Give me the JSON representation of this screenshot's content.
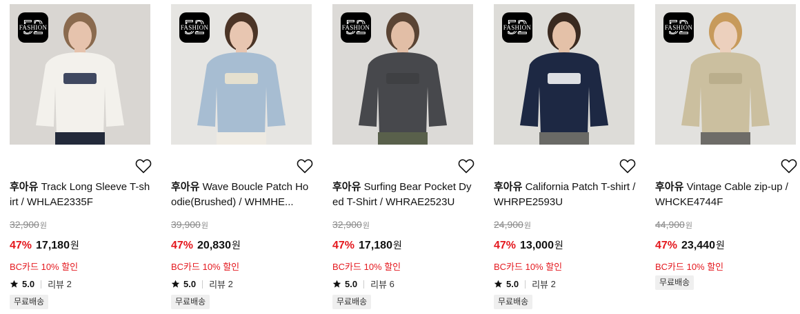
{
  "badge": {
    "number": "52",
    "word": "FASHION"
  },
  "products": [
    {
      "brand": "후아유",
      "name": "Track Long Sleeve T-shirt / WHLAE2335F",
      "original_price": "32,900",
      "currency": "원",
      "discount_rate": "47%",
      "sale_price": "17,180",
      "card_promo": "BC카드 10% 할인",
      "rating": "5.0",
      "review_label": "리뷰",
      "review_count": "2",
      "shipping_tag": "무료배송",
      "colors": {
        "bg": "#d9d6d2",
        "top": "#f3f1ec",
        "accent": "#1e2a48",
        "bottom": "#232a3a",
        "skin": "#e6c3ad",
        "hair": "#8a6a4e"
      }
    },
    {
      "brand": "후아유",
      "name": "Wave Boucle Patch Hoodie(Brushed) / WHMHE...",
      "original_price": "39,900",
      "currency": "원",
      "discount_rate": "47%",
      "sale_price": "20,830",
      "card_promo": "BC카드 10% 할인",
      "rating": "5.0",
      "review_label": "리뷰",
      "review_count": "2",
      "shipping_tag": "무료배송",
      "colors": {
        "bg": "#e6e5e2",
        "top": "#a7bdd2",
        "accent": "#f0e6cf",
        "bottom": "#eeeae2",
        "skin": "#e8c6b1",
        "hair": "#4b3426"
      }
    },
    {
      "brand": "후아유",
      "name": "Surfing Bear Pocket Dyed T-Shirt / WHRAE2523U",
      "original_price": "32,900",
      "currency": "원",
      "discount_rate": "47%",
      "sale_price": "17,180",
      "card_promo": "BC카드 10% 할인",
      "rating": "5.0",
      "review_label": "리뷰",
      "review_count": "6",
      "shipping_tag": "무료배송",
      "colors": {
        "bg": "#dcdad7",
        "top": "#47484c",
        "accent": "#3e4042",
        "bottom": "#59604b",
        "skin": "#e2bea6",
        "hair": "#5a4434"
      }
    },
    {
      "brand": "후아유",
      "name": "California Patch T-shirt / WHRPE2593U",
      "original_price": "24,900",
      "currency": "원",
      "discount_rate": "47%",
      "sale_price": "13,000",
      "card_promo": "BC카드 10% 할인",
      "rating": "5.0",
      "review_label": "리뷰",
      "review_count": "2",
      "shipping_tag": "무료배송",
      "colors": {
        "bg": "#dddcd8",
        "top": "#1d2843",
        "accent": "#ffffff",
        "bottom": "#6a6a66",
        "skin": "#e4c1a8",
        "hair": "#3a2a20"
      }
    },
    {
      "brand": "후아유",
      "name": "Vintage Cable zip-up / WHCKE4744F",
      "original_price": "44,900",
      "currency": "원",
      "discount_rate": "47%",
      "sale_price": "23,440",
      "card_promo": "BC카드 10% 할인",
      "rating": "",
      "review_label": "",
      "review_count": "",
      "shipping_tag": "무료배송",
      "colors": {
        "bg": "#e2e1de",
        "top": "#cbbf9f",
        "accent": "#b7aa88",
        "bottom": "#6e6c68",
        "skin": "#ecd0bd",
        "hair": "#c79a5b"
      }
    }
  ],
  "theme": {
    "sale_red": "#e4181e",
    "strike_gray": "#888888",
    "tag_bg": "#efefef"
  }
}
